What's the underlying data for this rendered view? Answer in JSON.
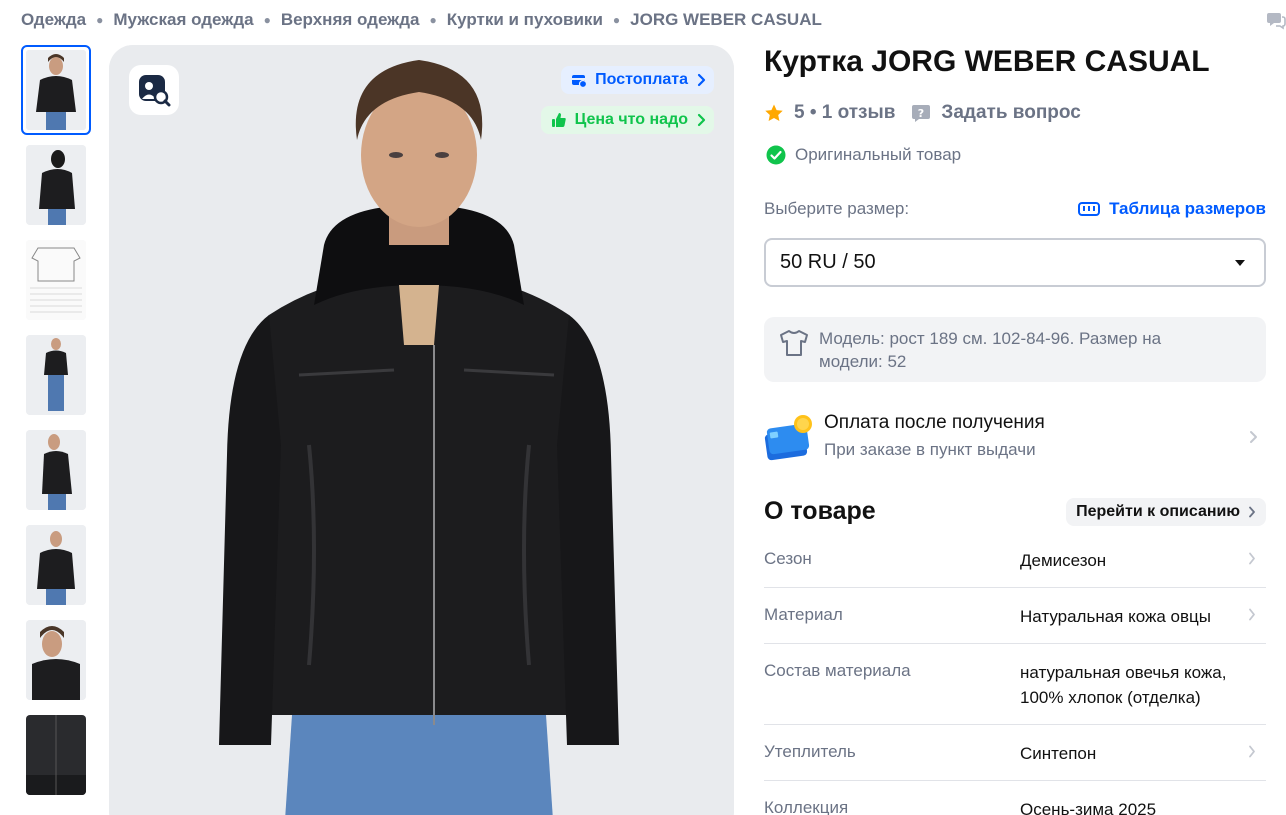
{
  "breadcrumbs": [
    "Одежда",
    "Мужская одежда",
    "Верхняя одежда",
    "Куртки и пуховики",
    "JORG WEBER CASUAL"
  ],
  "gallery": {
    "thumbnail_count": 8,
    "badges": {
      "postpay": "Постоплата",
      "good_price": "Цена что надо"
    }
  },
  "product": {
    "title": "Куртка JORG WEBER CASUAL",
    "rating_text": "5 • 1 отзыв",
    "ask_question": "Задать вопрос",
    "original": "Оригинальный товар"
  },
  "size": {
    "label": "Выберите размер:",
    "table_link": "Таблица размеров",
    "selected": "50 RU / 50"
  },
  "model_info": "Модель: рост 189 см. 102-84-96. Размер на модели: 52",
  "payment": {
    "title": "Оплата после получения",
    "subtitle": "При заказе в пункт выдачи"
  },
  "about": {
    "title": "О товаре",
    "goto_description": "Перейти к описанию",
    "specs": [
      {
        "label": "Сезон",
        "value": "Демисезон"
      },
      {
        "label": "Материал",
        "value": "Натуральная кожа овцы"
      },
      {
        "label": "Состав материала",
        "value": "натуральная овечья кожа, 100% хлопок (отделка)"
      },
      {
        "label": "Утеплитель",
        "value": "Синтепон"
      },
      {
        "label": "Коллекция",
        "value": "Осень-зима 2025"
      }
    ]
  },
  "colors": {
    "accent": "#005bff",
    "green": "#10c44c",
    "muted": "#6b7385",
    "star": "#ffa800"
  }
}
